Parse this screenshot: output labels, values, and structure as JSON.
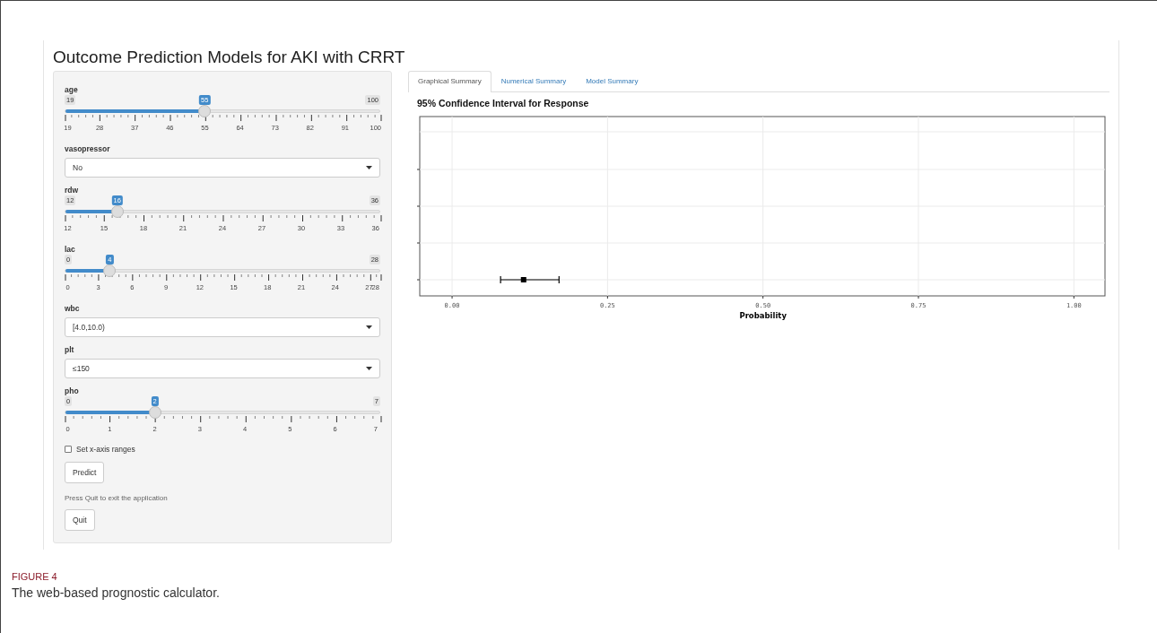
{
  "app": {
    "title": "Outcome Prediction Models for AKI with CRRT"
  },
  "sidebar": {
    "inputs": [
      {
        "kind": "slider",
        "label": "age",
        "min": "19",
        "max": "100",
        "value": "55",
        "level": 0.444,
        "ticks": [
          "19",
          "28",
          "37",
          "46",
          "55",
          "64",
          "73",
          "82",
          "91",
          "100"
        ]
      },
      {
        "kind": "select",
        "label": "vasopressor",
        "value": "No"
      },
      {
        "kind": "slider",
        "label": "rdw",
        "min": "12",
        "max": "36",
        "value": "16",
        "level": 0.167,
        "ticks": [
          "12",
          "15",
          "18",
          "21",
          "24",
          "27",
          "30",
          "33",
          "36"
        ]
      },
      {
        "kind": "slider",
        "label": "lac",
        "min": "0",
        "max": "28",
        "value": "4",
        "level": 0.143,
        "ticks": [
          "0",
          "3",
          "6",
          "9",
          "12",
          "15",
          "18",
          "21",
          "24",
          "27",
          "28"
        ]
      },
      {
        "kind": "select",
        "label": "wbc",
        "value": "[4.0,10.0)"
      },
      {
        "kind": "select",
        "label": "plt",
        "value": "≤150"
      },
      {
        "kind": "slider",
        "label": "pho",
        "min": "0",
        "max": "7",
        "value": "2",
        "level": 0.286,
        "ticks": [
          "0",
          "1",
          "2",
          "3",
          "4",
          "5",
          "6",
          "7"
        ]
      }
    ],
    "checkbox": {
      "label": "Set x-axis ranges",
      "checked": false
    },
    "predict_button": "Predict",
    "quit_note": "Press Quit to exit the application",
    "quit_button": "Quit"
  },
  "tabs": [
    {
      "label": "Graphical Summary",
      "selected": true
    },
    {
      "label": "Numerical Summary",
      "selected": false
    },
    {
      "label": "Model Summary",
      "selected": false
    }
  ],
  "chart_data": {
    "type": "scatter",
    "orientation": "horizontal",
    "title": "95% Confidence Interval for Response",
    "xlabel": "Probability",
    "xlim": [
      -0.052,
      1.05
    ],
    "xticks": [
      {
        "value": 0,
        "label": "0.00"
      },
      {
        "value": 0.25,
        "label": "0.25"
      },
      {
        "value": 0.5,
        "label": "0.50"
      },
      {
        "value": 0.75,
        "label": "0.75"
      },
      {
        "value": 1,
        "label": "1.00"
      }
    ],
    "grid": true,
    "series": [
      {
        "color": "#000000",
        "values": [
          0.115
        ],
        "errors": [
          [
            0.078,
            0.172
          ]
        ]
      }
    ]
  },
  "caption": {
    "label": "FIGURE 4",
    "text": "The web-based prognostic calculator."
  }
}
